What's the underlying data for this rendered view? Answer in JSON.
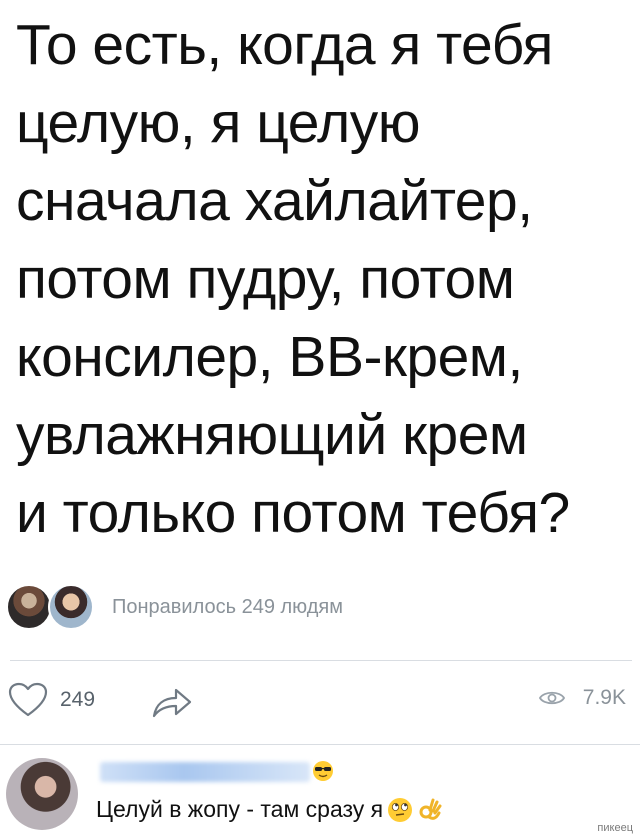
{
  "post": {
    "text": "То есть, когда я тебя\nцелую, я целую\nсначала хайлайтер,\nпотом пудру, потом\nконсилер, BB-крем,\nувлажняющий крем\nи только потом тебя?"
  },
  "likes_summary": {
    "text": "Понравилось 249 людям"
  },
  "actions": {
    "like_count": "249",
    "views_count": "7.9K",
    "like_icon": "heart-icon",
    "share_icon": "share-arrow-icon",
    "views_icon": "eye-icon"
  },
  "comment": {
    "text": "Целуй в жопу - там сразу я",
    "author_emoji": "sunglasses-emoji",
    "trailing_emoji": [
      "rolling-eyes-emoji",
      "ok-hand-emoji"
    ]
  },
  "watermark": "пикеец",
  "colors": {
    "text": "#111111",
    "muted": "#8a9299",
    "divider": "#d9dde2"
  }
}
